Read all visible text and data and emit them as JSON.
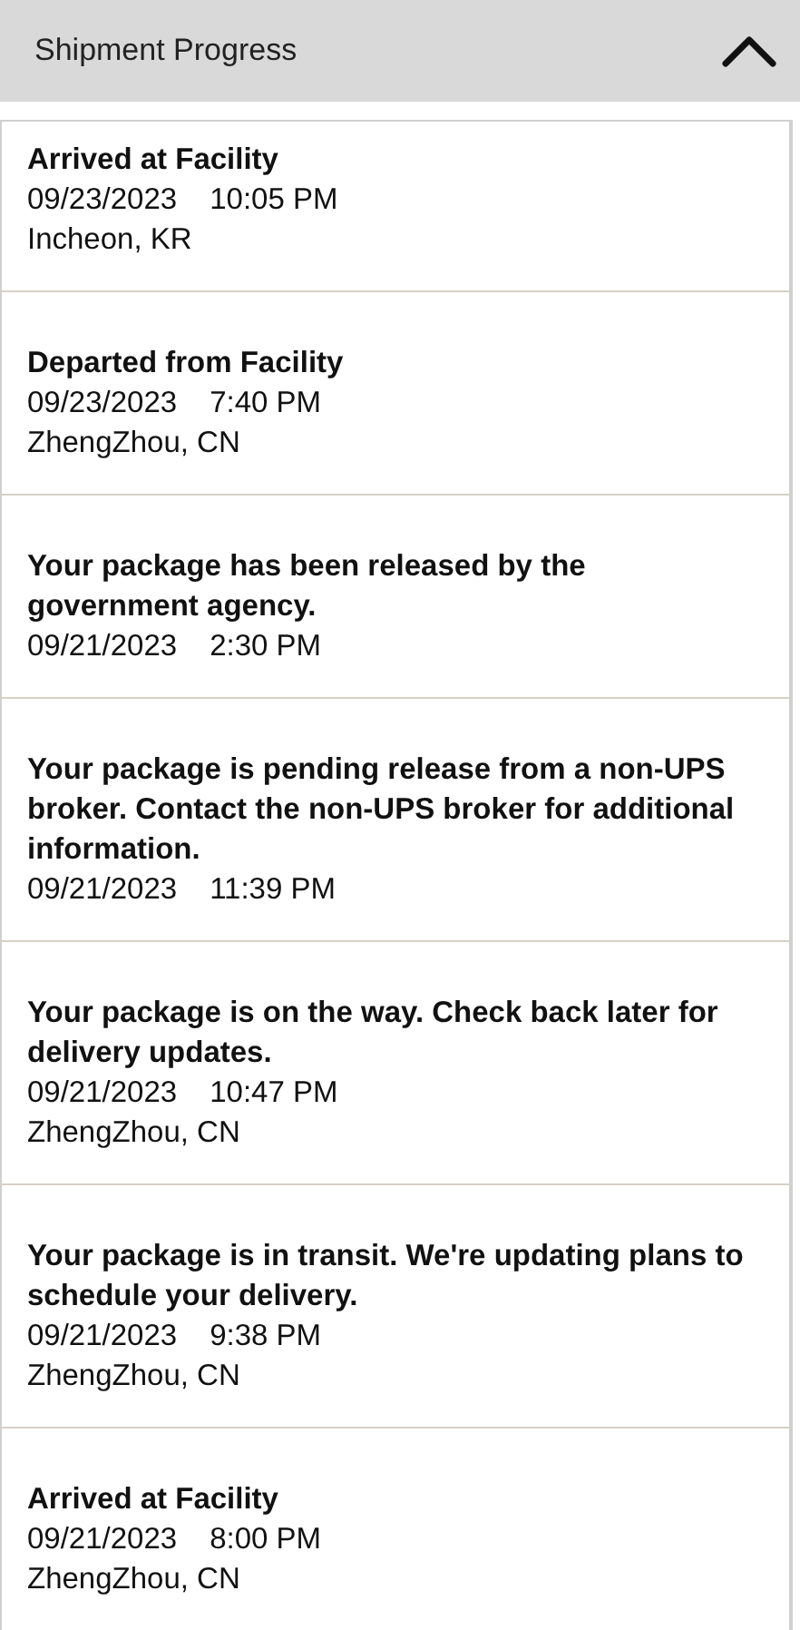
{
  "header": {
    "title": "Shipment Progress",
    "expanded": true
  },
  "events": [
    {
      "status": "Arrived at Facility",
      "date": "09/23/2023",
      "time": "10:05 PM",
      "location": "Incheon, KR"
    },
    {
      "status": "Departed from Facility",
      "date": "09/23/2023",
      "time": "7:40 PM",
      "location": "ZhengZhou, CN"
    },
    {
      "status": "Your package has been released by the government agency.",
      "date": "09/21/2023",
      "time": "2:30 PM"
    },
    {
      "status": "Your package is pending release from a non-UPS broker. Contact the non-UPS broker for additional information.",
      "date": "09/21/2023",
      "time": "11:39 PM"
    },
    {
      "status": "Your package is on the way. Check back later for delivery updates.",
      "date": "09/21/2023",
      "time": "10:47 PM",
      "location": "ZhengZhou, CN"
    },
    {
      "status": "Your package is in transit. We're updating plans to schedule your delivery.",
      "date": "09/21/2023",
      "time": "9:38 PM",
      "location": "ZhengZhou, CN"
    },
    {
      "status": "Arrived at Facility",
      "date": "09/21/2023",
      "time": "8:00 PM",
      "location": "ZhengZhou, CN"
    }
  ]
}
